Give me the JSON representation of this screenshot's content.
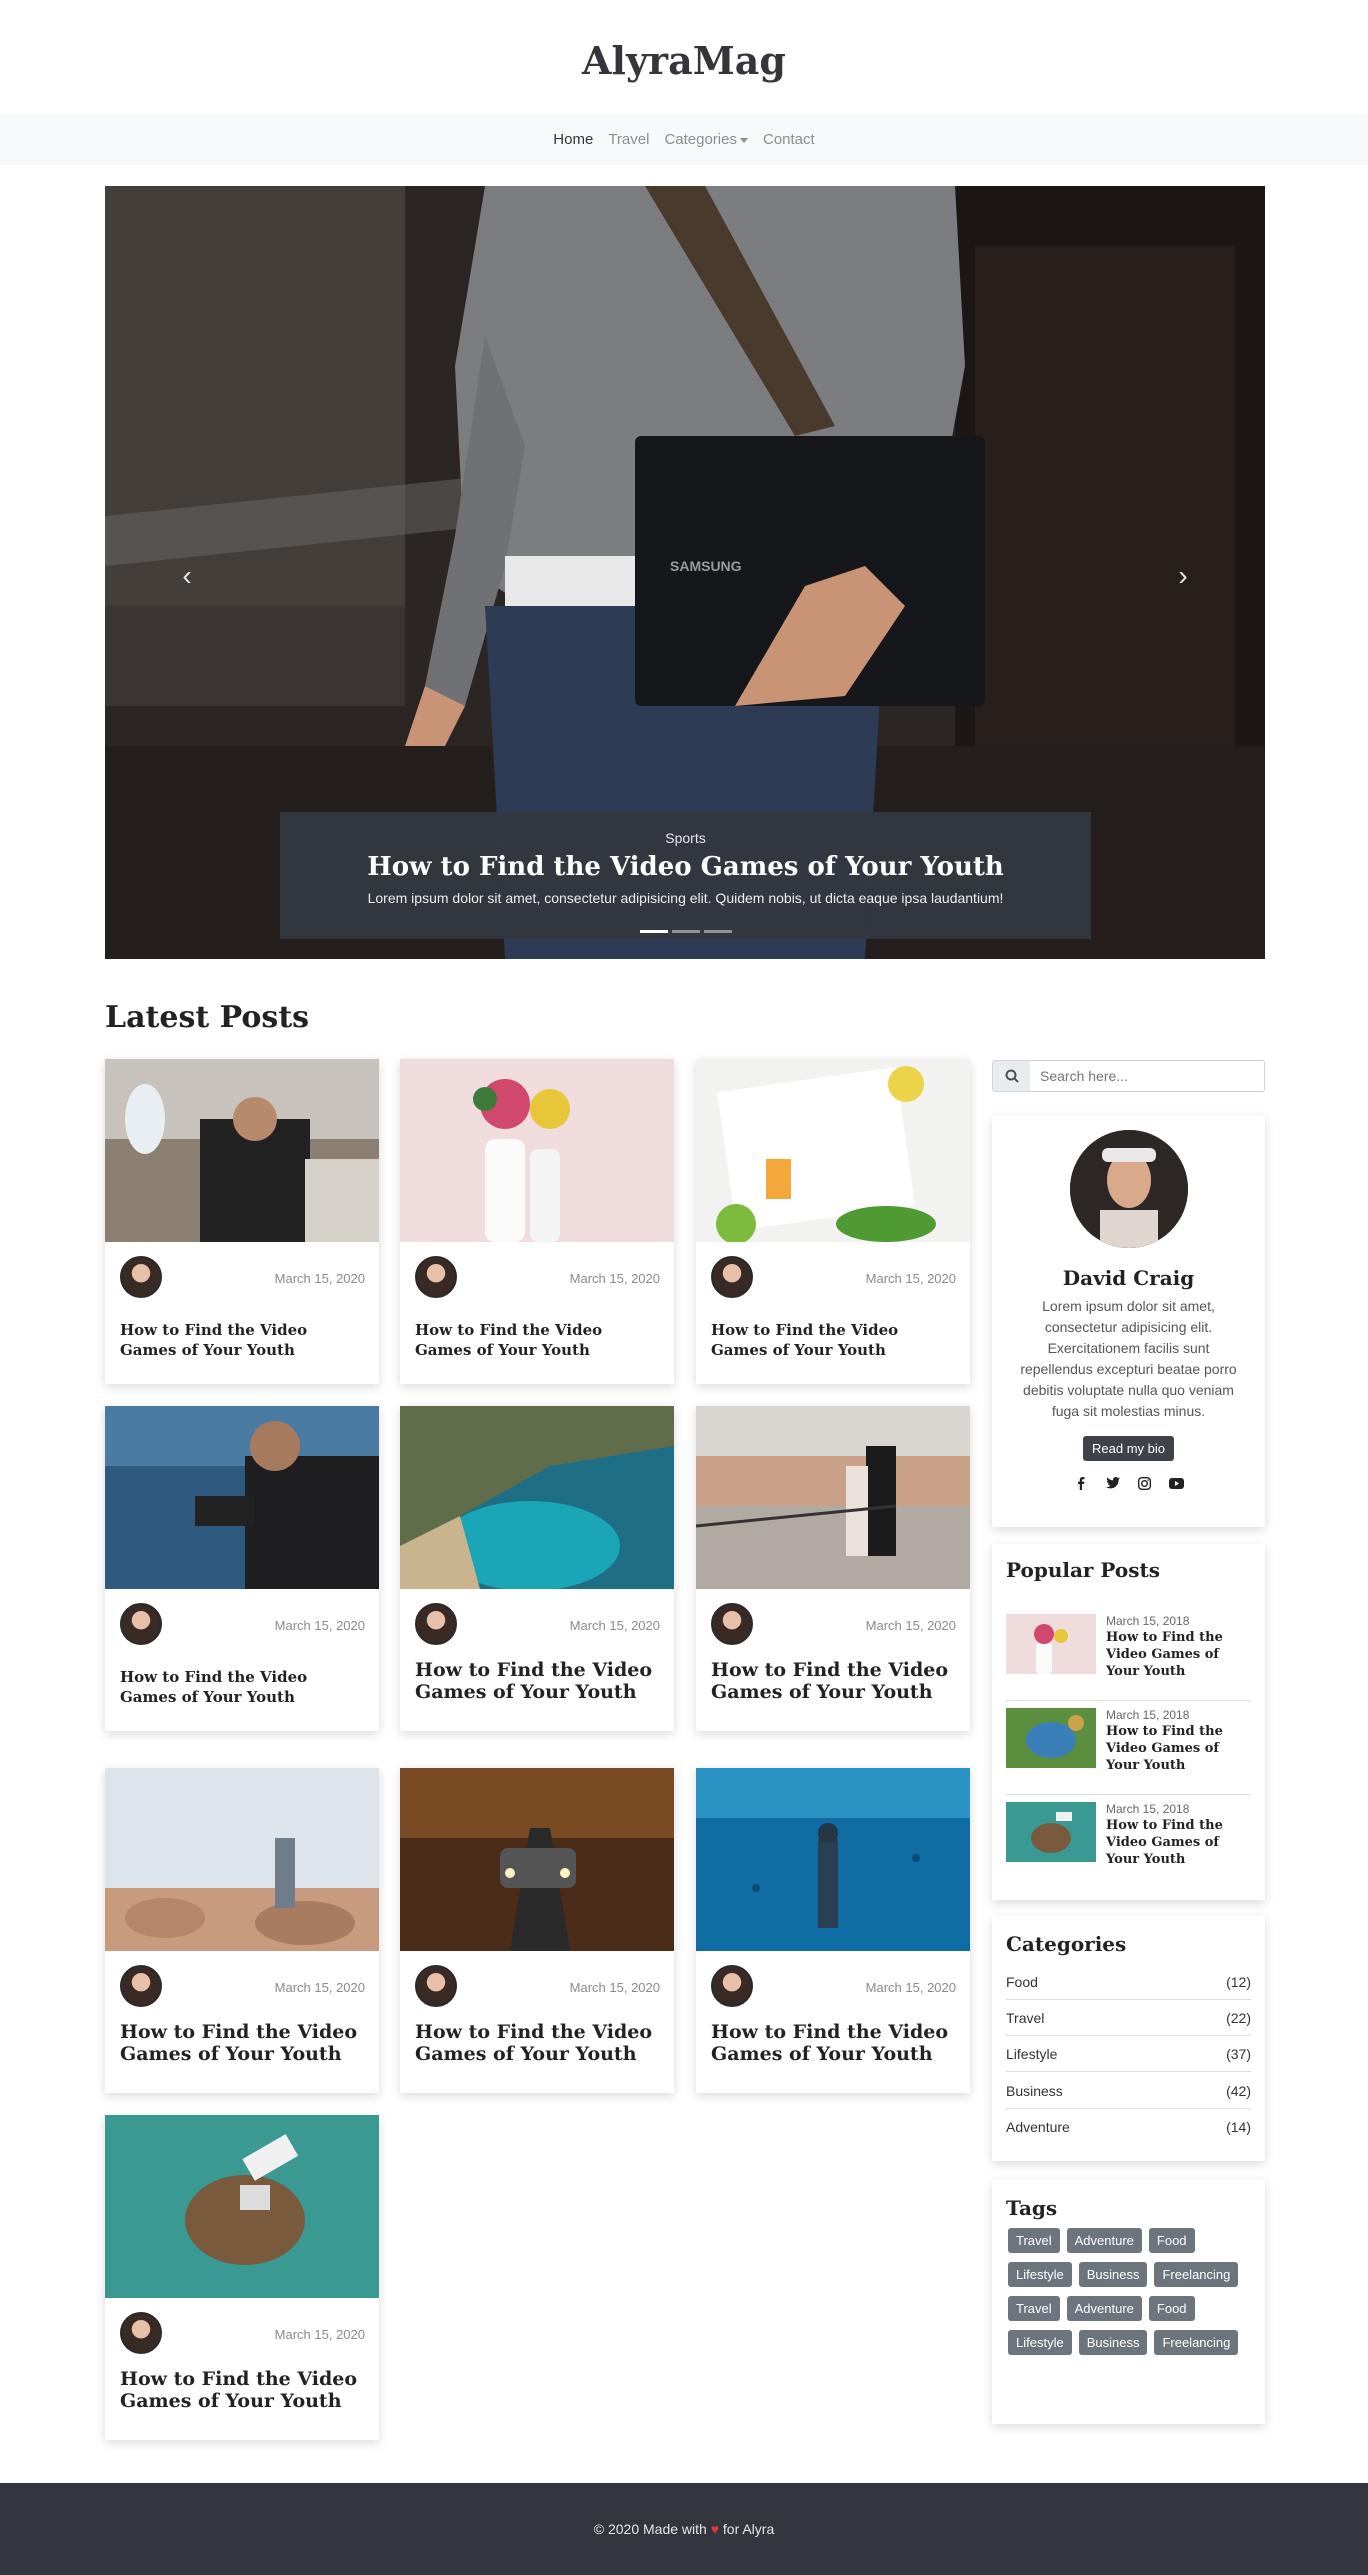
{
  "brand": "AlyraMag",
  "nav": [
    {
      "label": "Home",
      "active": true
    },
    {
      "label": "Travel"
    },
    {
      "label": "Categories",
      "dropdown": true
    },
    {
      "label": "Contact"
    }
  ],
  "hero": {
    "category": "Sports",
    "title": "How to Find the Video Games of Your Youth",
    "text": "Lorem ipsum dolor sit amet, consectetur adipisicing elit. Quidem nobis, ut dicta eaque ipsa laudantium!",
    "prev_icon": "chevron-left-icon",
    "next_icon": "chevron-right-icon",
    "laptop_brand": "SAMSUNG",
    "slides": 3,
    "active_slide": 1
  },
  "latest": {
    "title": "Latest Posts",
    "posts": [
      {
        "date": "March 15, 2020",
        "title": "How to Find the Video Games of Your Youth"
      },
      {
        "date": "March 15, 2020",
        "title": "How to Find the Video Games of Your Youth"
      },
      {
        "date": "March 15, 2020",
        "title": "How to Find the Video Games of Your Youth"
      },
      {
        "date": "March 15, 2020",
        "title": "How to Find the Video Games of Your Youth"
      },
      {
        "date": "March 15, 2020",
        "title": "How to Find the Video Games of Your Youth"
      },
      {
        "date": "March 15, 2020",
        "title": "How to Find the Video Games of Your Youth"
      },
      {
        "date": "March 15, 2020",
        "title": "How to Find the Video Games of Your Youth"
      },
      {
        "date": "March 15, 2020",
        "title": "How to Find the Video Games of Your Youth"
      },
      {
        "date": "March 15, 2020",
        "title": "How to Find the Video Games of Your Youth"
      },
      {
        "date": "March 15, 2020",
        "title": "How to Find the Video Games of Your Youth"
      }
    ]
  },
  "search": {
    "placeholder": "Search here...",
    "icon": "search-icon"
  },
  "profile": {
    "name": "David Craig",
    "bio": "Lorem ipsum dolor sit amet, consectetur adipisicing elit. Exercitationem facilis sunt repellendus excepturi beatae porro debitis voluptate nulla quo veniam fuga sit molestias minus.",
    "button": "Read my bio",
    "social": [
      "facebook-icon",
      "twitter-icon",
      "instagram-icon",
      "youtube-icon"
    ]
  },
  "popular": {
    "title": "Popular Posts",
    "posts": [
      {
        "date": "March 15, 2018",
        "title": "How to Find the Video Games of Your Youth"
      },
      {
        "date": "March 15, 2018",
        "title": "How to Find the Video Games of Your Youth"
      },
      {
        "date": "March 15, 2018",
        "title": "How to Find the Video Games of Your Youth"
      }
    ]
  },
  "categories": {
    "title": "Categories",
    "items": [
      {
        "name": "Food",
        "count": "(12)"
      },
      {
        "name": "Travel",
        "count": "(22)"
      },
      {
        "name": "Lifestyle",
        "count": "(37)"
      },
      {
        "name": "Business",
        "count": "(42)"
      },
      {
        "name": "Adventure",
        "count": "(14)"
      }
    ]
  },
  "tags": {
    "title": "Tags",
    "items": [
      "Travel",
      "Adventure",
      "Food",
      "Lifestyle",
      "Business",
      "Freelancing",
      "Travel",
      "Adventure",
      "Food",
      "Lifestyle",
      "Business",
      "Freelancing"
    ]
  },
  "footer": {
    "prefix": "© 2020 Made with",
    "suffix": "for Alyra"
  },
  "colors": {
    "dark": "#34363d",
    "accent_heart": "#e0393e",
    "tag_bg": "#6c757d"
  }
}
